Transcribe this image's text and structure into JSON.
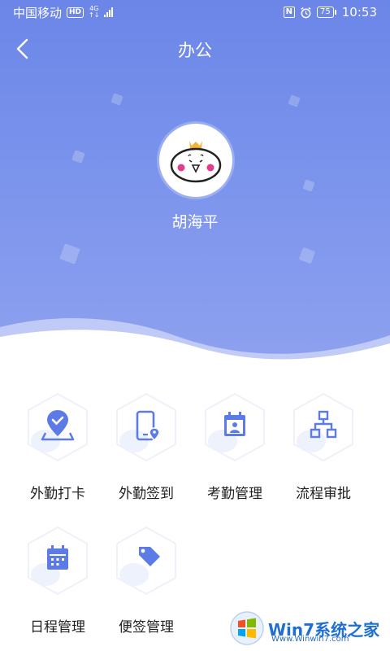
{
  "status_bar": {
    "carrier": "中国移动",
    "hd": "HD",
    "network": "4G",
    "battery": "75",
    "time": "10:53"
  },
  "header": {
    "title": "办公",
    "user_name": "胡海平",
    "gradient_top": "#6b86e8",
    "gradient_bottom": "#8ea1ef"
  },
  "tiles": [
    {
      "label": "外勤打卡",
      "icon": "location-check-icon"
    },
    {
      "label": "外勤签到",
      "icon": "phone-location-icon"
    },
    {
      "label": "考勤管理",
      "icon": "calendar-person-icon"
    },
    {
      "label": "流程审批",
      "icon": "org-chart-icon"
    },
    {
      "label": "日程管理",
      "icon": "calendar-icon"
    },
    {
      "label": "便签管理",
      "icon": "tag-icon"
    }
  ],
  "accent_color": "#5d7be6",
  "watermark": {
    "text": "Win7系统之家",
    "url": "Www.Winwin7.com"
  }
}
